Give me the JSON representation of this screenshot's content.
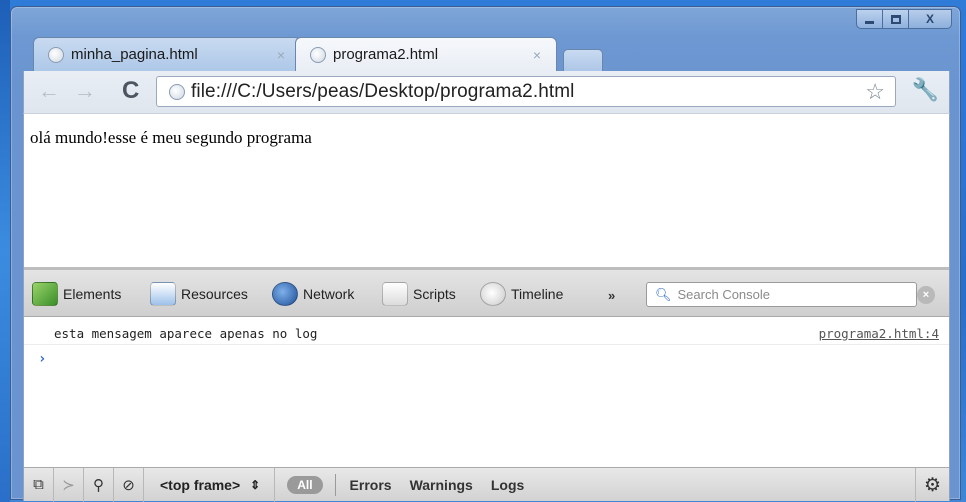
{
  "window": {
    "controls": {
      "minimize": "minimize-icon",
      "maximize": "maximize-icon",
      "close": "X"
    }
  },
  "tabs": [
    {
      "title": "minha_pagina.html",
      "close": "×",
      "active": false
    },
    {
      "title": "programa2.html",
      "close": "×",
      "active": true
    }
  ],
  "toolbar": {
    "back": "←",
    "forward": "→",
    "reload": "C",
    "url": "file:///C:/Users/peas/Desktop/programa2.html",
    "star": "☆",
    "wrench": "🔧"
  },
  "page": {
    "text": "olá mundo!esse é meu segundo programa"
  },
  "devtools": {
    "tabs": [
      "Elements",
      "Resources",
      "Network",
      "Scripts",
      "Timeline"
    ],
    "more": "»",
    "search_placeholder": "Search Console",
    "console": {
      "message": "esta mensagem aparece apenas no log",
      "source": "programa2.html:4",
      "prompt": "›"
    },
    "statusbar": {
      "frame": "<top frame>",
      "frame_arrows": "⇕",
      "all": "All",
      "filters": [
        "Errors",
        "Warnings",
        "Logs"
      ]
    }
  }
}
